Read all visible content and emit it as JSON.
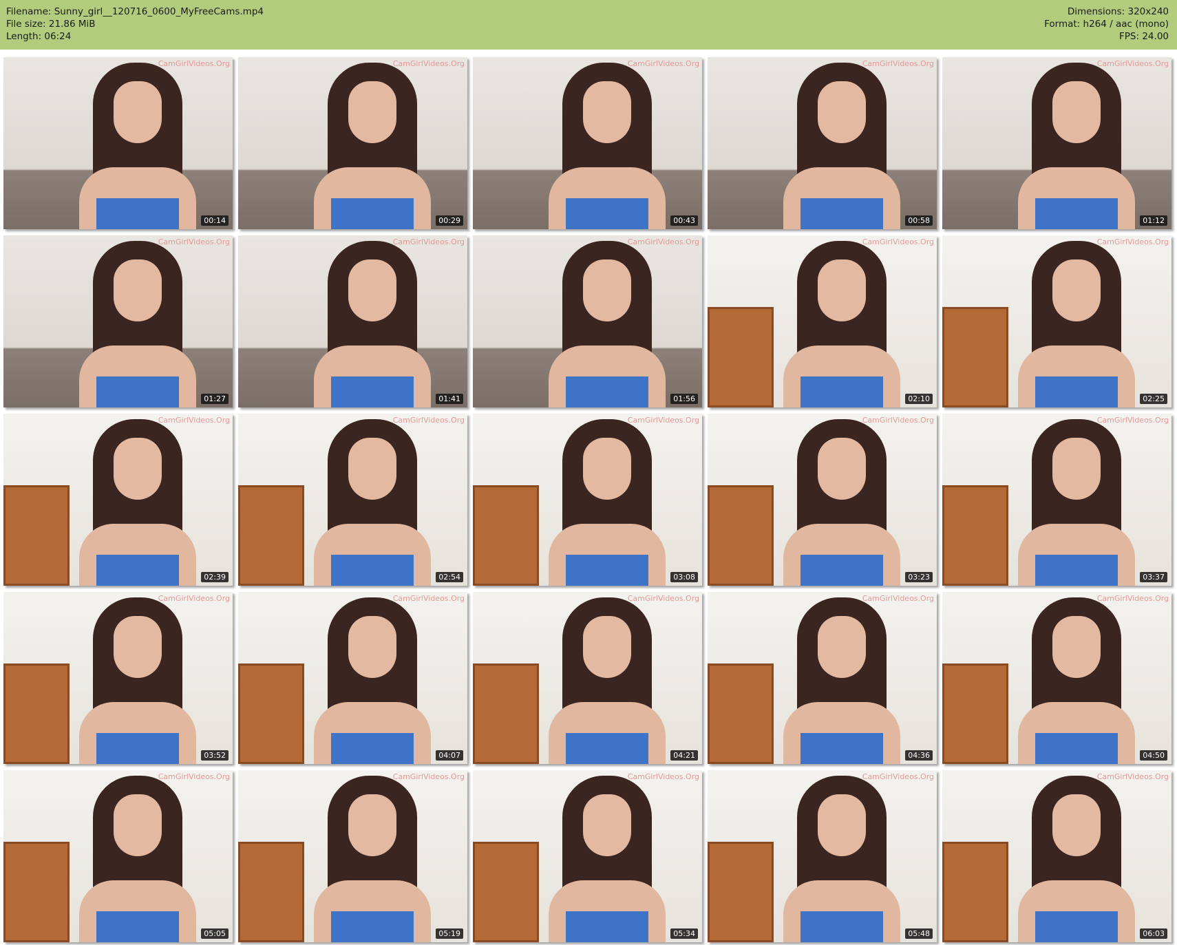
{
  "header": {
    "filename": "Filename: Sunny_girl__120716_0600_MyFreeCams.mp4",
    "file_size": "File size: 21.86 MiB",
    "length": "Length: 06:24",
    "dimensions": "Dimensions: 320x240",
    "format": "Format: h264 / aac (mono)",
    "fps": "FPS: 24.00"
  },
  "watermark": "CamGirlVideos.Org",
  "thumbnails": [
    {
      "time": "00:14",
      "scene": "sofa"
    },
    {
      "time": "00:29",
      "scene": "sofa"
    },
    {
      "time": "00:43",
      "scene": "sofa"
    },
    {
      "time": "00:58",
      "scene": "sofa"
    },
    {
      "time": "01:12",
      "scene": "sofa"
    },
    {
      "time": "01:27",
      "scene": "sofa"
    },
    {
      "time": "01:41",
      "scene": "sofa"
    },
    {
      "time": "01:56",
      "scene": "sofa"
    },
    {
      "time": "02:10",
      "scene": "room"
    },
    {
      "time": "02:25",
      "scene": "room"
    },
    {
      "time": "02:39",
      "scene": "room"
    },
    {
      "time": "02:54",
      "scene": "room"
    },
    {
      "time": "03:08",
      "scene": "room"
    },
    {
      "time": "03:23",
      "scene": "room"
    },
    {
      "time": "03:37",
      "scene": "room"
    },
    {
      "time": "03:52",
      "scene": "room"
    },
    {
      "time": "04:07",
      "scene": "room"
    },
    {
      "time": "04:21",
      "scene": "room"
    },
    {
      "time": "04:36",
      "scene": "room"
    },
    {
      "time": "04:50",
      "scene": "room"
    },
    {
      "time": "05:05",
      "scene": "room"
    },
    {
      "time": "05:19",
      "scene": "room"
    },
    {
      "time": "05:34",
      "scene": "room"
    },
    {
      "time": "05:48",
      "scene": "room"
    },
    {
      "time": "06:03",
      "scene": "room"
    }
  ]
}
